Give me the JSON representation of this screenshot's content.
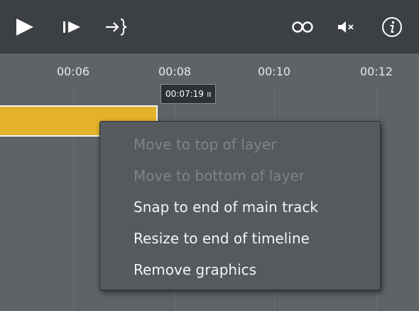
{
  "toolbar": {
    "icons": [
      "play-icon",
      "step-play-icon",
      "jump-to-end-icon",
      "loop-icon",
      "mute-icon",
      "info-icon"
    ],
    "colors": {
      "background": "#3c3f43",
      "icon": "#ffffff"
    }
  },
  "ruler": {
    "ticks": [
      "00:06",
      "00:08",
      "00:10",
      "00:12"
    ]
  },
  "playhead": {
    "time": "00:07:19"
  },
  "clip": {
    "color": "#e4b22a"
  },
  "context_menu": {
    "items": [
      {
        "label": "Move to top of layer",
        "enabled": false
      },
      {
        "label": "Move to bottom of layer",
        "enabled": false
      },
      {
        "label": "Snap to end of main track",
        "enabled": true
      },
      {
        "label": "Resize to end of timeline",
        "enabled": true
      },
      {
        "label": "Remove graphics",
        "enabled": true
      }
    ]
  }
}
